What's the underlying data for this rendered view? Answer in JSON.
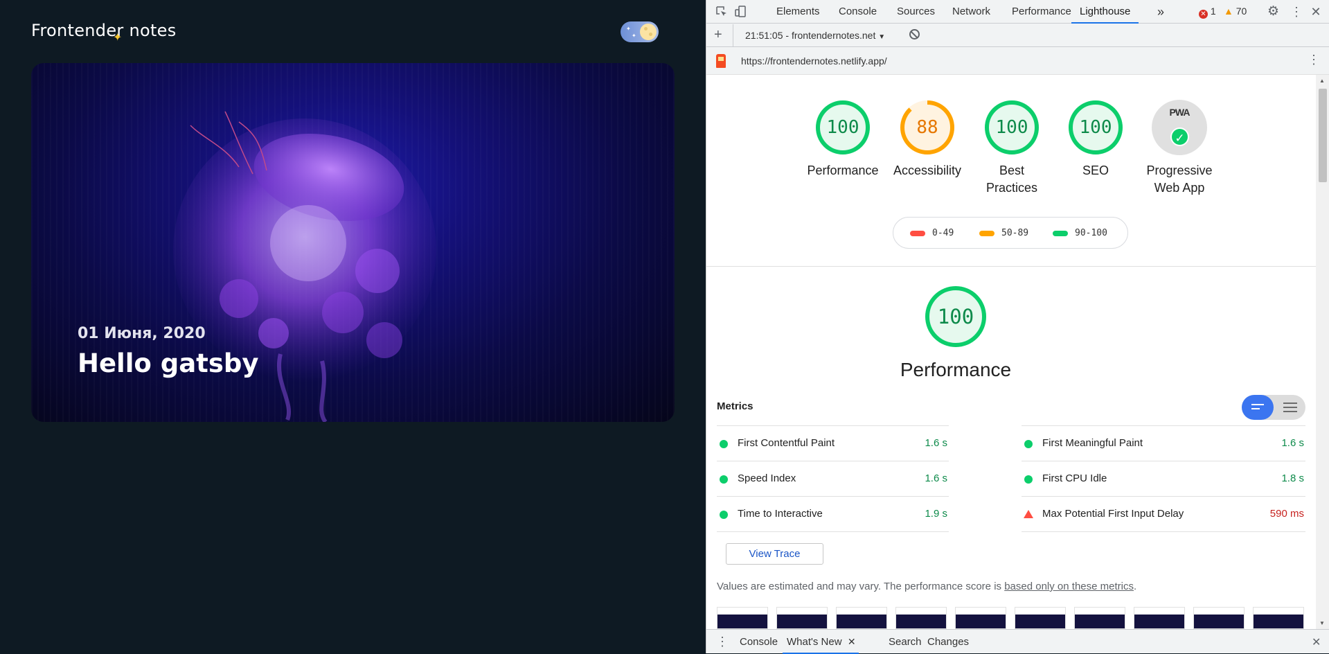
{
  "site": {
    "title": "Frontender notes",
    "post_date": "01 Июня, 2020",
    "post_title": "Hello gatsby"
  },
  "devtools": {
    "tabs": [
      "Elements",
      "Console",
      "Sources",
      "Network",
      "Performance",
      "Lighthouse"
    ],
    "active_tab": "Lighthouse",
    "more_tabs_icon": "chevron-double-right-icon",
    "errors": "1",
    "warnings": "70",
    "report_selector": "21:51:05 - frontendernotes.net",
    "url": "https://frontendernotes.netlify.app/"
  },
  "lighthouse": {
    "gauges": [
      {
        "score": "100",
        "label": "Performance",
        "fraction": 1.0,
        "color": "#0cce6b"
      },
      {
        "score": "88",
        "label": "Accessibility",
        "fraction": 0.88,
        "color": "#ffa400"
      },
      {
        "score": "100",
        "label": "Best Practices",
        "fraction": 1.0,
        "color": "#0cce6b"
      },
      {
        "score": "100",
        "label": "SEO",
        "fraction": 1.0,
        "color": "#0cce6b"
      }
    ],
    "pwa": {
      "badge": "PWA",
      "label": "Progressive Web App"
    },
    "legend": [
      {
        "range": "0-49",
        "color": "#ff4e42"
      },
      {
        "range": "50-89",
        "color": "#ffa400"
      },
      {
        "range": "90-100",
        "color": "#0cce6b"
      }
    ],
    "performance": {
      "score": "100",
      "title": "Performance"
    },
    "metrics_heading": "Metrics",
    "metrics": [
      {
        "name": "First Contentful Paint",
        "value": "1.6 s",
        "status": "pass"
      },
      {
        "name": "First Meaningful Paint",
        "value": "1.6 s",
        "status": "pass"
      },
      {
        "name": "Speed Index",
        "value": "1.6 s",
        "status": "pass"
      },
      {
        "name": "First CPU Idle",
        "value": "1.8 s",
        "status": "pass"
      },
      {
        "name": "Time to Interactive",
        "value": "1.9 s",
        "status": "pass"
      },
      {
        "name": "Max Potential First Input Delay",
        "value": "590 ms",
        "status": "fail"
      }
    ],
    "view_trace": "View Trace",
    "note_text": "Values are estimated and may vary. The performance score is ",
    "note_link": "based only on these metrics",
    "note_end": "."
  },
  "drawer": {
    "tabs": [
      "Console",
      "What's New",
      "Search",
      "Changes"
    ],
    "active_tab": "What's New"
  }
}
